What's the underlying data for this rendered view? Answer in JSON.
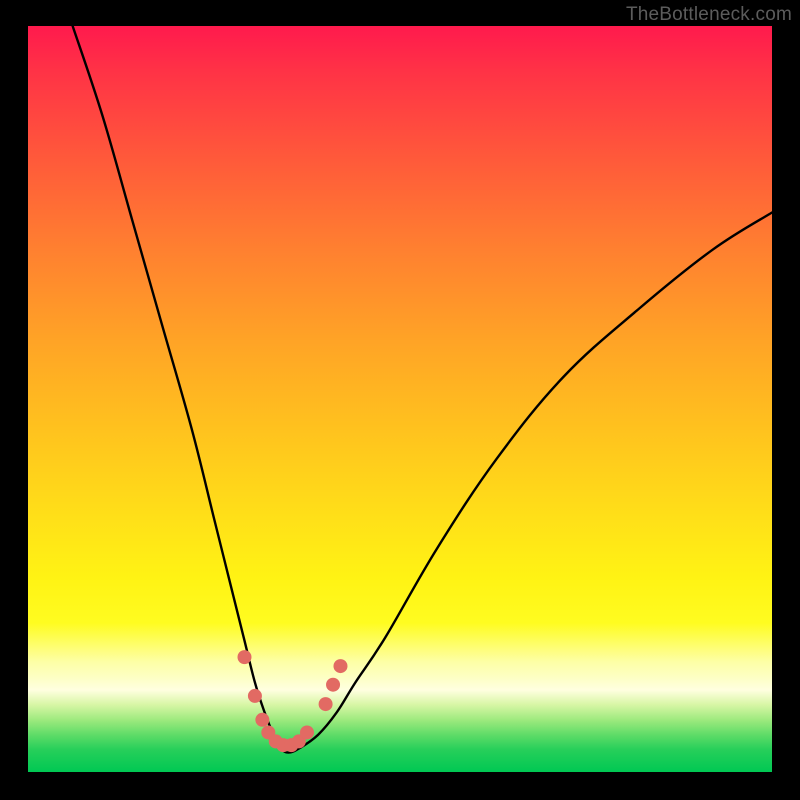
{
  "attribution": "TheBottleneck.com",
  "chart_data": {
    "type": "line",
    "title": "",
    "xlabel": "",
    "ylabel": "",
    "xlim": [
      0,
      100
    ],
    "ylim": [
      0,
      100
    ],
    "background_gradient": {
      "stops": [
        {
          "pos": 0.0,
          "color": "#ff1a4d"
        },
        {
          "pos": 0.18,
          "color": "#ff5a3a"
        },
        {
          "pos": 0.42,
          "color": "#ffa326"
        },
        {
          "pos": 0.66,
          "color": "#ffe018"
        },
        {
          "pos": 0.85,
          "color": "#fdffa5"
        },
        {
          "pos": 1.0,
          "color": "#00c853"
        }
      ]
    },
    "series": [
      {
        "name": "bottleneck-curve",
        "color": "#000000",
        "x": [
          6,
          10,
          14,
          18,
          22,
          25,
          27,
          29,
          30.5,
          31.8,
          33,
          34,
          35,
          36.5,
          39,
          41.5,
          44,
          48,
          55,
          63,
          72,
          82,
          92,
          100
        ],
        "y": [
          100,
          88,
          74,
          60,
          46,
          34,
          26,
          18,
          12,
          8,
          5,
          3.2,
          2.6,
          3.2,
          5,
          8,
          12,
          18,
          30,
          42,
          53,
          62,
          70,
          75
        ]
      }
    ],
    "markers": [
      {
        "x": 29.1,
        "y": 15.4,
        "r": 7,
        "color": "#e26a63"
      },
      {
        "x": 30.5,
        "y": 10.2,
        "r": 7,
        "color": "#e26a63"
      },
      {
        "x": 31.5,
        "y": 7.0,
        "r": 7,
        "color": "#e26a63"
      },
      {
        "x": 32.3,
        "y": 5.3,
        "r": 7,
        "color": "#e26a63"
      },
      {
        "x": 33.3,
        "y": 4.1,
        "r": 7,
        "color": "#e26a63"
      },
      {
        "x": 34.3,
        "y": 3.6,
        "r": 7,
        "color": "#e26a63"
      },
      {
        "x": 35.4,
        "y": 3.6,
        "r": 7,
        "color": "#e26a63"
      },
      {
        "x": 36.4,
        "y": 4.1,
        "r": 7,
        "color": "#e26a63"
      },
      {
        "x": 37.5,
        "y": 5.3,
        "r": 7,
        "color": "#e26a63"
      },
      {
        "x": 40.0,
        "y": 9.1,
        "r": 7,
        "color": "#e26a63"
      },
      {
        "x": 41.0,
        "y": 11.7,
        "r": 7,
        "color": "#e26a63"
      },
      {
        "x": 42.0,
        "y": 14.2,
        "r": 7,
        "color": "#e26a63"
      }
    ]
  }
}
